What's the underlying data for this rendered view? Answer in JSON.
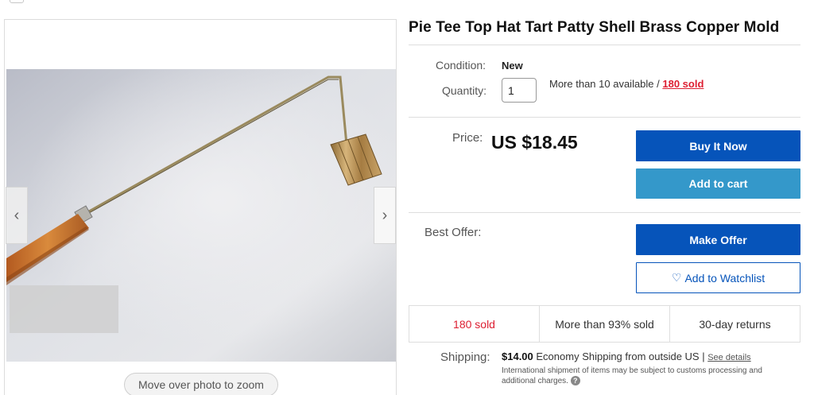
{
  "gallery": {
    "zoom_hint": "Move over photo to zoom",
    "prev_icon": "chevron-left-icon",
    "next_icon": "chevron-right-icon"
  },
  "item": {
    "title": "Pie Tee Top Hat Tart Patty Shell Brass Copper Mold",
    "condition_label": "Condition:",
    "condition_value": "New",
    "quantity_label": "Quantity:",
    "quantity_value": "1",
    "availability": "More than 10 available / ",
    "sold_link": "180 sold"
  },
  "price": {
    "label": "Price:",
    "value": "US $18.45",
    "buy_now": "Buy It Now",
    "add_to_cart": "Add to cart"
  },
  "offer": {
    "label": "Best Offer:",
    "make_offer": "Make Offer",
    "watchlist": "Add to Watchlist",
    "watch_icon": "heart-icon",
    "watch_glyph": "♡"
  },
  "stats": [
    {
      "text": "180 sold"
    },
    {
      "text": "More than 93% sold"
    },
    {
      "text": "30-day returns"
    }
  ],
  "shipping": {
    "label": "Shipping:",
    "cost": "$14.00",
    "method": "Economy Shipping from outside US | ",
    "details_link": "See details",
    "note": "International shipment of items may be subject to customs processing and additional charges.",
    "help_icon": "question-icon"
  },
  "colors": {
    "primary_button": "#0654ba",
    "secondary_button": "#3498ca",
    "sold_red": "#dd1e31"
  }
}
